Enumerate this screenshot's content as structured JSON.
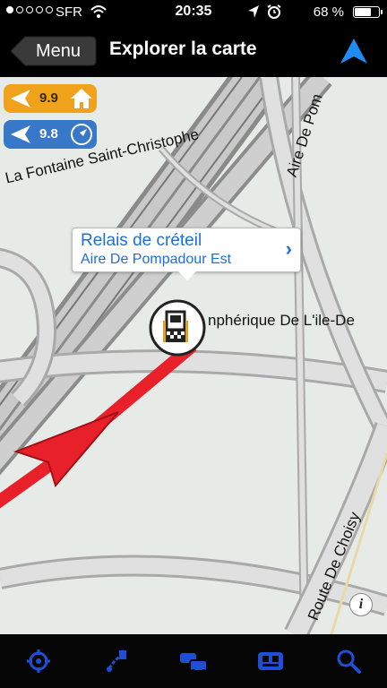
{
  "status_bar": {
    "carrier": "SFR",
    "time": "20:35",
    "battery_percent": "68 %",
    "battery_level": 0.68,
    "signal_dots_filled": 1
  },
  "nav": {
    "back_label": "Menu",
    "title": "Explorer la carte",
    "accent_color": "#1e8cf0"
  },
  "map": {
    "labels": {
      "street1": "La Fontaine Saint-Christophe",
      "street2": "Aire De Pom",
      "street3": "nphérique De L'ile-De",
      "street4": "Route De Choisy"
    },
    "badges": [
      {
        "value": "9.9",
        "icon": "home-icon",
        "color": "#f0a21b"
      },
      {
        "value": "9.8",
        "icon": "compass-icon",
        "color": "#3878c8"
      }
    ],
    "callout": {
      "title": "Relais de créteil",
      "subtitle": "Aire De Pompadour Est"
    },
    "poi_icon": "fuel-station-icon",
    "position_marker_color": "#e8202a"
  },
  "tab_bar": {
    "icon_color": "#1e4fd8",
    "items": [
      "locate-icon",
      "route-icon",
      "traffic-icon",
      "poi-icon",
      "search-icon"
    ]
  }
}
